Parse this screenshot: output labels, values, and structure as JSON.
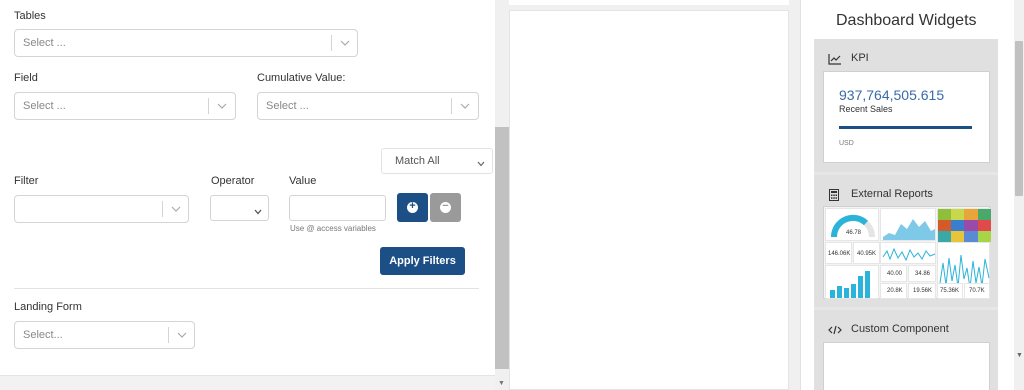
{
  "filters": {
    "tables_label": "Tables",
    "tables_placeholder": "Select ...",
    "field_label": "Field",
    "field_placeholder": "Select ...",
    "cumulative_label": "Cumulative Value:",
    "cumulative_placeholder": "Select ...",
    "match_mode": "Match All",
    "filter_label": "Filter",
    "operator_label": "Operator",
    "value_label": "Value",
    "value_hint": "Use @ access variables",
    "add_icon": "plus-icon",
    "remove_icon": "minus-icon",
    "apply_label": "Apply Filters",
    "landing_label": "Landing Form",
    "landing_placeholder": "Select..."
  },
  "widgets": {
    "title": "Dashboard Widgets",
    "kpi": {
      "label": "KPI",
      "icon": "line-chart-icon",
      "value": "937,764,505.615",
      "subtitle": "Recent Sales",
      "currency": "USD"
    },
    "external_reports": {
      "label": "External Reports",
      "icon": "calculator-icon",
      "thumb_values": [
        "46.78",
        "146.06K",
        "40.95K",
        "40.00",
        "34.86",
        "20.8K",
        "19.56K",
        "75.36K",
        "70.7K"
      ]
    },
    "custom_component": {
      "label": "Custom Component",
      "icon": "code-icon"
    }
  },
  "colors": {
    "primary": "#1b4f86",
    "kpi_value": "#3b6aa8",
    "secondary_button": "#9a9a9a"
  }
}
